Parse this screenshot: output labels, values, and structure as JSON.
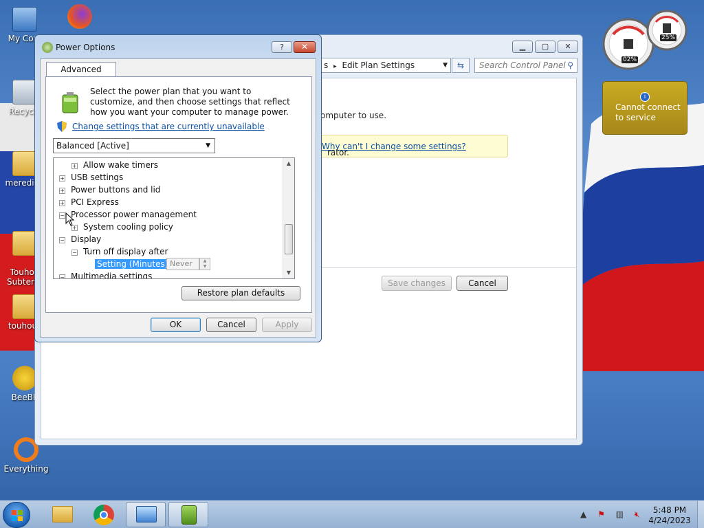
{
  "desktop": {
    "icons": [
      {
        "label": "My Com",
        "name": "my-computer"
      },
      {
        "label": "Recycle",
        "name": "recycle-bin"
      },
      {
        "label": "meredian",
        "name": "meredian"
      },
      {
        "label": "Touhou\nSubterra",
        "name": "touhou-subterra"
      },
      {
        "label": "touhou_",
        "name": "touhou"
      },
      {
        "label": "BeeBE",
        "name": "beebe"
      },
      {
        "label": "Everything",
        "name": "everything"
      }
    ]
  },
  "gadgets": {
    "meter": {
      "cpu": "02%",
      "memory": "25%"
    },
    "weather": {
      "message": "Cannot connect to service"
    }
  },
  "back_window": {
    "breadcrumb_suffix": "s",
    "breadcrumb": "Edit Plan Settings",
    "search_placeholder": "Search Control Panel",
    "body_text": "omputer to use.",
    "notice_text": "rator.",
    "notice_link": "Why can't I change some settings?",
    "save_label": "Save changes",
    "cancel_label": "Cancel"
  },
  "dialog": {
    "title": "Power Options",
    "help_label": "?",
    "close_label": "✕",
    "tab_label": "Advanced settings",
    "intro_text": "Select the power plan that you want to customize, and then choose settings that reflect how you want your computer to manage power.",
    "change_link": "Change settings that are currently unavailable",
    "plan_selected": "Balanced [Active]",
    "tree": [
      {
        "label": "Allow wake timers",
        "level": 1,
        "state": "+"
      },
      {
        "label": "USB settings",
        "level": 0,
        "state": "+"
      },
      {
        "label": "Power buttons and lid",
        "level": 0,
        "state": "+"
      },
      {
        "label": "PCI Express",
        "level": 0,
        "state": "+"
      },
      {
        "label": "Processor power management",
        "level": 0,
        "state": "-"
      },
      {
        "label": "System cooling policy",
        "level": 1,
        "state": "+"
      },
      {
        "label": "Display",
        "level": 0,
        "state": "-"
      },
      {
        "label": "Turn off display after",
        "level": 1,
        "state": "-"
      },
      {
        "label": "Setting (Minutes):",
        "level": 2,
        "state": ""
      },
      {
        "label": "Multimedia settings",
        "level": 0,
        "state": "-"
      }
    ],
    "setting_value": "Never",
    "restore_label": "Restore plan defaults",
    "ok_label": "OK",
    "cancel_label": "Cancel",
    "apply_label": "Apply"
  },
  "taskbar": {
    "time": "5:48 PM",
    "date": "4/24/2023"
  }
}
